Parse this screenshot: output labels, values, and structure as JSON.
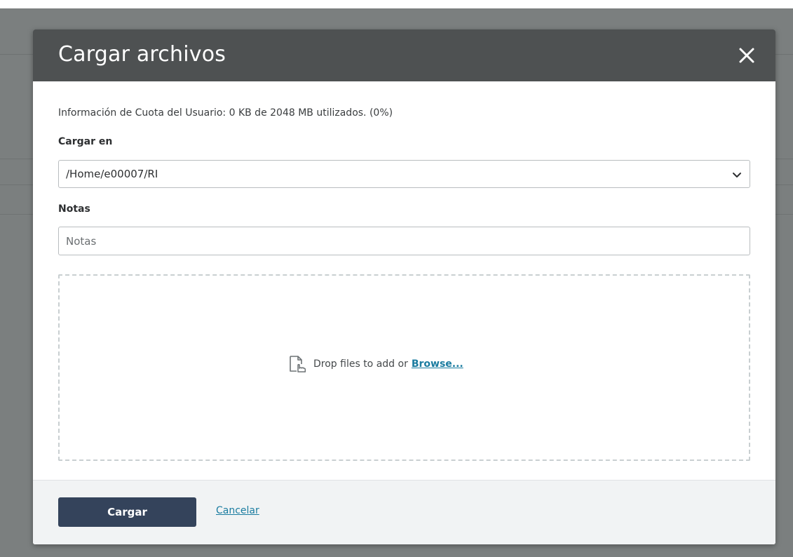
{
  "dialog": {
    "title": "Cargar archivos",
    "close_icon": "close-icon",
    "quota_text": "Información de Cuota del Usuario: 0 KB de 2048 MB utilizados. (0%)",
    "upload_to": {
      "label": "Cargar en",
      "selected": "/Home/e00007/RI"
    },
    "notes": {
      "label": "Notas",
      "placeholder": "Notas",
      "value": ""
    },
    "dropzone": {
      "icon": "file-drop-icon",
      "text": "Drop files to add or",
      "browse_label": "Browse..."
    },
    "footer": {
      "submit_label": "Cargar",
      "cancel_label": "Cancelar"
    }
  },
  "colors": {
    "header_bg": "#4e5152",
    "primary_button": "#34435b",
    "link": "#1a7ca0",
    "overlay": "#7b7f7f"
  }
}
